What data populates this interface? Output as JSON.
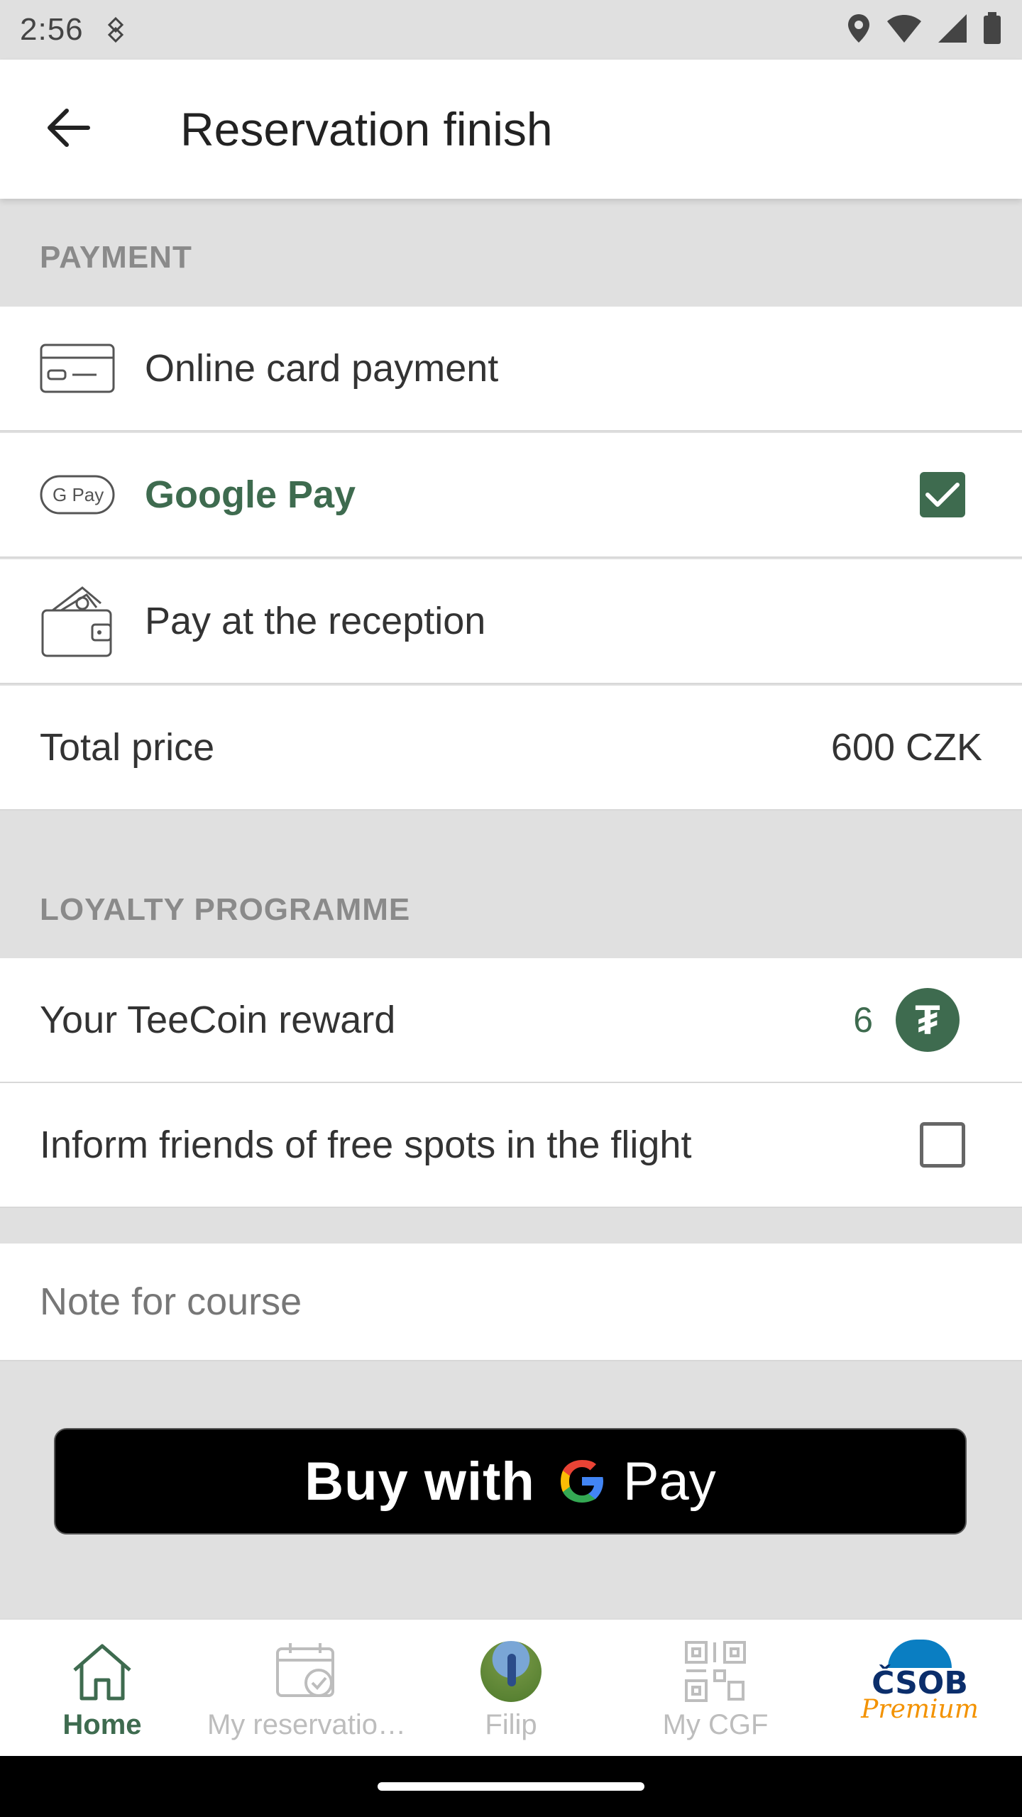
{
  "status_bar": {
    "time": "2:56"
  },
  "header": {
    "title": "Reservation finish"
  },
  "payment": {
    "section_title": "PAYMENT",
    "options": [
      {
        "label": "Online card payment",
        "icon": "credit-card-icon",
        "selected": false
      },
      {
        "label": "Google Pay",
        "icon": "gpay-icon",
        "badge": "G Pay",
        "selected": true
      },
      {
        "label": "Pay at the reception",
        "icon": "wallet-icon",
        "selected": false
      }
    ],
    "total_label": "Total price",
    "total_value": "600 CZK"
  },
  "loyalty": {
    "section_title": "LOYALTY PROGRAMME",
    "reward_label": "Your TeeCoin reward",
    "reward_value": "6",
    "coin_symbol": "₮",
    "inform_label": "Inform friends of free spots in the flight",
    "inform_checked": false
  },
  "note": {
    "placeholder": "Note for course"
  },
  "buy_button": {
    "buy_with": "Buy with",
    "pay": "Pay"
  },
  "bottom_nav": {
    "items": [
      {
        "label": "Home",
        "icon": "home-icon",
        "active": true
      },
      {
        "label": "My reservatio…",
        "icon": "calendar-check-icon",
        "active": false
      },
      {
        "label": "Filip",
        "icon": "avatar",
        "active": false
      },
      {
        "label": "My CGF",
        "icon": "qr-code-icon",
        "active": false
      },
      {
        "label": "",
        "icon": "csob-premium-logo",
        "active": false
      }
    ],
    "csob_text": "ČSOB",
    "csob_sub": "Premium"
  },
  "colors": {
    "accent": "#3e6b4f",
    "section_bg": "#e0e0e0",
    "csob_blue": "#0a7ec2",
    "csob_orange": "#f39200"
  }
}
